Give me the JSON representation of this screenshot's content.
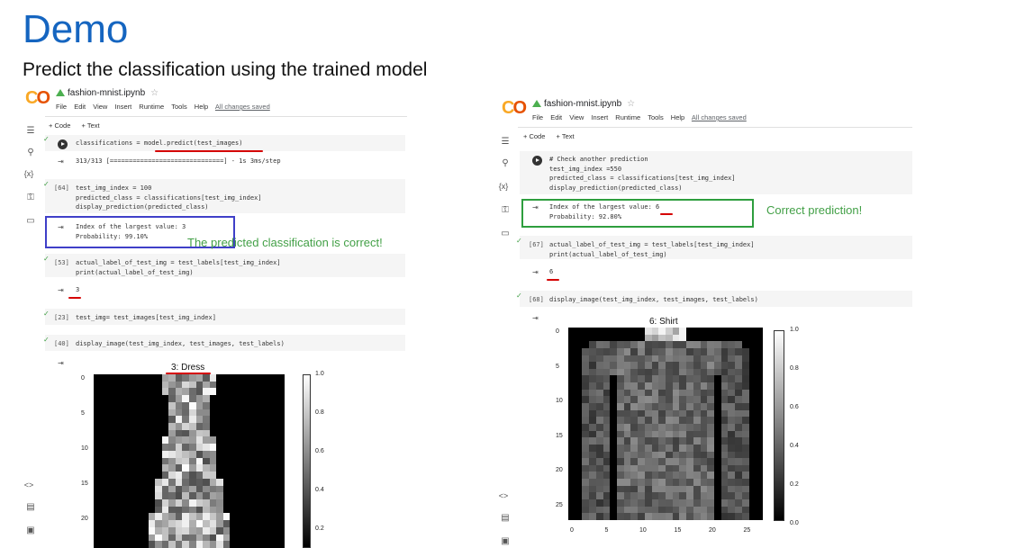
{
  "slide": {
    "title": "Demo",
    "subtitle": "Predict the classification using the trained model"
  },
  "left": {
    "logo": "CO",
    "notebook_name": "fashion-mnist.ipynb",
    "menu": [
      "File",
      "Edit",
      "View",
      "Insert",
      "Runtime",
      "Tools",
      "Help"
    ],
    "saved_status": "All changes saved",
    "toolbar": [
      "+ Code",
      "+ Text"
    ],
    "cells": [
      {
        "num": "",
        "code": "classifications = model.predict(test_images)",
        "output": "313/313 [==============================] - 1s 3ms/step"
      },
      {
        "num": "[64]",
        "code": "test_img_index = 100\npredicted_class = classifications[test_img_index]\ndisplay_prediction(predicted_class)",
        "output": "Index of the largest value: 3\nProbability: 99.10%"
      },
      {
        "num": "[53]",
        "code": "actual_label_of_test_img = test_labels[test_img_index]\nprint(actual_label_of_test_img)",
        "output": "3"
      },
      {
        "num": "[23]",
        "code": "test_img= test_images[test_img_index]",
        "output": ""
      },
      {
        "num": "[40]",
        "code": "display_image(test_img_index, test_images, test_labels)",
        "output": ""
      }
    ],
    "annotation": "The predicted classification is correct!",
    "annotation_color": "#43a047",
    "box_color": "#3f3fc8",
    "plot": {
      "title": "3: Dress",
      "y_ticks": [
        "0",
        "5",
        "10",
        "15",
        "20"
      ],
      "cbar_ticks": [
        "1.0",
        "0.8",
        "0.6",
        "0.4",
        "0.2"
      ]
    },
    "side_icons": [
      "menu-icon",
      "search-icon",
      "variables-icon",
      "key-icon",
      "folder-icon",
      "code-icon",
      "terminal-list-icon",
      "terminal-icon"
    ]
  },
  "right": {
    "logo": "CO",
    "notebook_name": "fashion-mnist.ipynb",
    "menu": [
      "File",
      "Edit",
      "View",
      "Insert",
      "Runtime",
      "Tools",
      "Help"
    ],
    "saved_status": "All changes saved",
    "toolbar": [
      "+ Code",
      "+ Text"
    ],
    "cells": [
      {
        "num": "",
        "code": "# Check another prediction\ntest_img_index =550\npredicted_class = classifications[test_img_index]\ndisplay_prediction(predicted_class)",
        "output": "Index of the largest value: 6\nProbability: 92.80%"
      },
      {
        "num": "[67]",
        "code": "actual_label_of_test_img = test_labels[test_img_index]\nprint(actual_label_of_test_img)",
        "output": "6"
      },
      {
        "num": "[68]",
        "code": "display_image(test_img_index, test_images, test_labels)",
        "output": ""
      }
    ],
    "annotation": "Correct prediction!",
    "annotation_color": "#43a047",
    "box_color": "#2e9e3e",
    "plot": {
      "title": "6: Shirt",
      "y_ticks": [
        "0",
        "5",
        "10",
        "15",
        "20",
        "25"
      ],
      "x_ticks": [
        "0",
        "5",
        "10",
        "15",
        "20",
        "25"
      ],
      "cbar_ticks": [
        "1.0",
        "0.8",
        "0.6",
        "0.4",
        "0.2",
        "0.0"
      ]
    }
  }
}
